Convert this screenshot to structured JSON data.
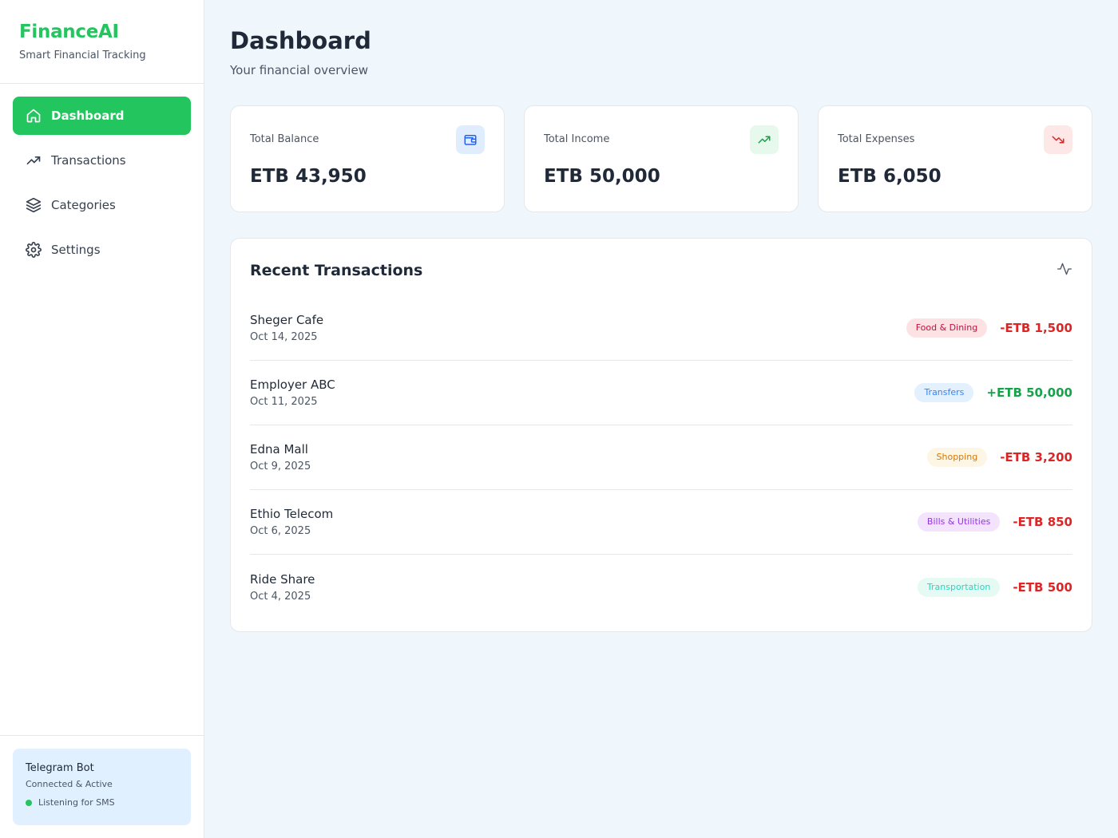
{
  "brand": {
    "title": "FinanceAI",
    "subtitle": "Smart Financial Tracking"
  },
  "nav": [
    {
      "label": "Dashboard",
      "icon": "home-icon",
      "active": true
    },
    {
      "label": "Transactions",
      "icon": "trending-up-icon",
      "active": false
    },
    {
      "label": "Categories",
      "icon": "layers-icon",
      "active": false
    },
    {
      "label": "Settings",
      "icon": "gear-icon",
      "active": false
    }
  ],
  "bot": {
    "title": "Telegram Bot",
    "subtitle": "Connected & Active",
    "status": "Listening for SMS",
    "status_color": "#22c55e"
  },
  "header": {
    "title": "Dashboard",
    "subtitle": "Your financial overview"
  },
  "stats": [
    {
      "label": "Total Balance",
      "value": "ETB 43,950",
      "icon": "wallet-icon",
      "icon_color": "#2563eb",
      "icon_bg": "#e0edff"
    },
    {
      "label": "Total Income",
      "value": "ETB 50,000",
      "icon": "trending-up-icon",
      "icon_color": "#16a34a",
      "icon_bg": "#e6f9ec"
    },
    {
      "label": "Total Expenses",
      "value": "ETB 6,050",
      "icon": "trending-down-icon",
      "icon_color": "#dc2626",
      "icon_bg": "#fde7e7"
    }
  ],
  "recent": {
    "title": "Recent Transactions",
    "icon": "activity-icon",
    "items": [
      {
        "name": "Sheger Cafe",
        "date": "Oct 14, 2025",
        "category": "Food & Dining",
        "amount": "-ETB 1,500",
        "amount_color": "#dc2626",
        "badge_bg": "#fde2e4",
        "badge_color": "#be123c"
      },
      {
        "name": "Employer ABC",
        "date": "Oct 11, 2025",
        "category": "Transfers",
        "amount": "+ETB 50,000",
        "amount_color": "#16a34a",
        "badge_bg": "#e3f0fd",
        "badge_color": "#3b82f6"
      },
      {
        "name": "Edna Mall",
        "date": "Oct 9, 2025",
        "category": "Shopping",
        "amount": "-ETB 3,200",
        "amount_color": "#dc2626",
        "badge_bg": "#fef6e4",
        "badge_color": "#d97706"
      },
      {
        "name": "Ethio Telecom",
        "date": "Oct 6, 2025",
        "category": "Bills & Utilities",
        "amount": "-ETB 850",
        "amount_color": "#dc2626",
        "badge_bg": "#f3e3fd",
        "badge_color": "#9333ea"
      },
      {
        "name": "Ride Share",
        "date": "Oct 4, 2025",
        "category": "Transportation",
        "amount": "-ETB 500",
        "amount_color": "#dc2626",
        "badge_bg": "#e6faf4",
        "badge_color": "#2dd4bf"
      }
    ]
  }
}
